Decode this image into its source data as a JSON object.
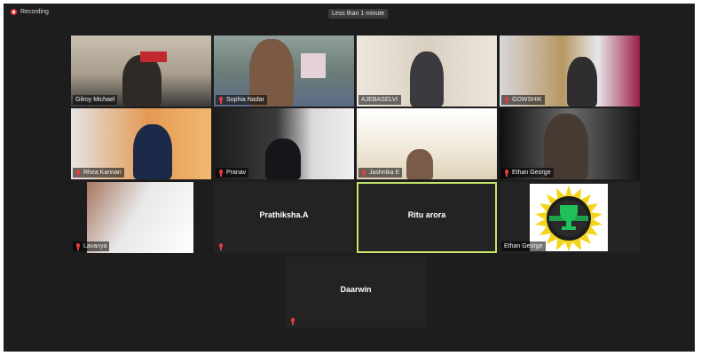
{
  "meeting": {
    "recording_label": "Recording",
    "timer_label": "Less than 1 minute"
  },
  "participants": [
    {
      "name": "Gilroy Michael",
      "muted": false,
      "video": true
    },
    {
      "name": "Sophia Nadar",
      "muted": true,
      "video": true
    },
    {
      "name": "AJEBASELVI",
      "muted": false,
      "video": true
    },
    {
      "name": "GOWSHIK",
      "muted": true,
      "video": true
    },
    {
      "name": "Rhea Kannan",
      "muted": true,
      "video": true
    },
    {
      "name": "Pranav",
      "muted": true,
      "video": true
    },
    {
      "name": "Jashnika E",
      "muted": true,
      "video": true
    },
    {
      "name": "Ethan George",
      "muted": true,
      "video": true
    },
    {
      "name": "Lavanya",
      "muted": true,
      "video": true
    },
    {
      "name": "Prathiksha.A",
      "muted": true,
      "video": false
    },
    {
      "name": "Ritu arora",
      "muted": false,
      "video": false,
      "active_speaker": true
    },
    {
      "name": "Ethan George",
      "muted": false,
      "video": true
    },
    {
      "name": "Daarwin",
      "muted": true,
      "video": false
    }
  ],
  "colors": {
    "background": "#1d1d1d",
    "tile": "#232323",
    "active_border": "#c6e36a",
    "muted_red": "#e53b3b"
  }
}
